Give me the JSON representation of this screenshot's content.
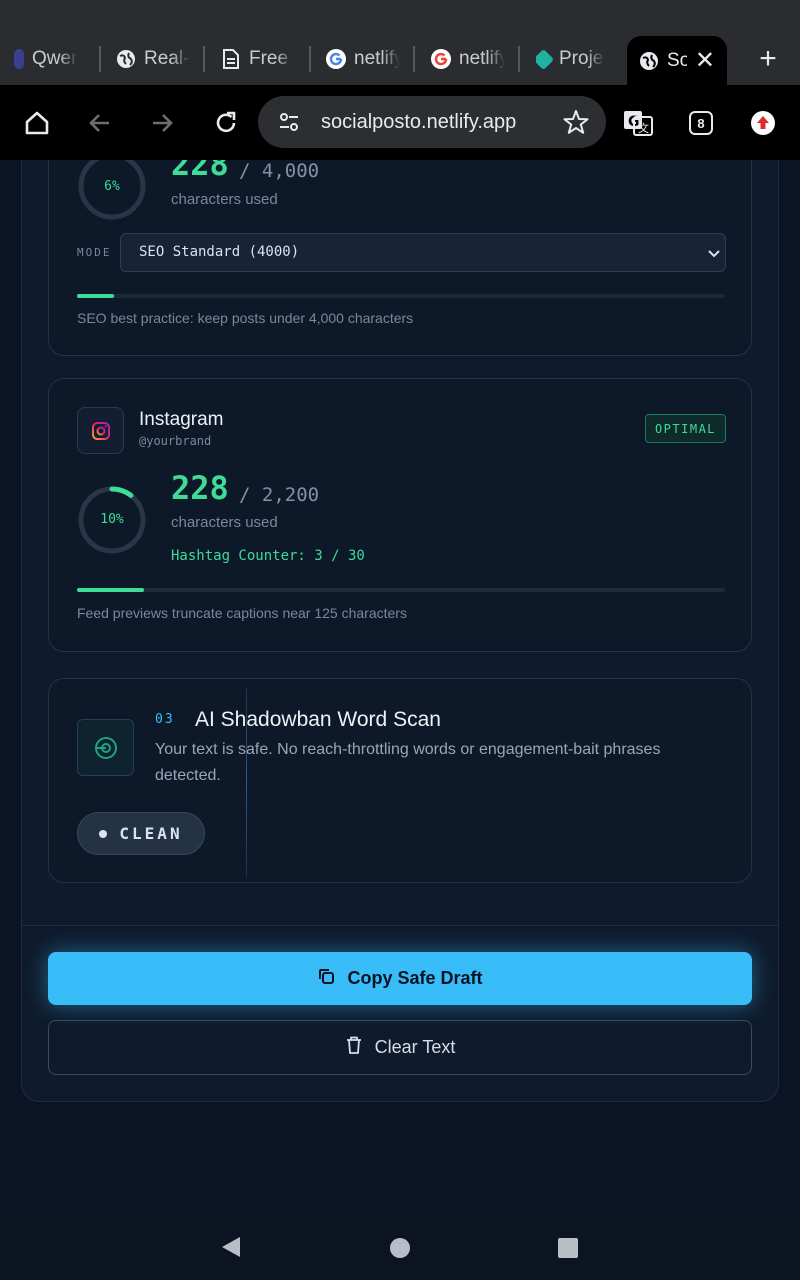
{
  "browser": {
    "tabs": [
      {
        "label": "Qwen",
        "favicon": "qwen-icon"
      },
      {
        "label": "Real-t",
        "favicon": "globe-icon"
      },
      {
        "label": "Free G",
        "favicon": "document-icon"
      },
      {
        "label": "netlify",
        "favicon": "google-icon"
      },
      {
        "label": "netlify",
        "favicon": "google-icon"
      },
      {
        "label": "Projec",
        "favicon": "netlify-icon"
      }
    ],
    "active_tab": {
      "label": "So",
      "favicon": "globe-icon"
    },
    "url": "socialposto.netlify.app",
    "tab_count": "8"
  },
  "linkedin_card": {
    "ring_percent_label": "6%",
    "ring_fraction": 0.057,
    "count": "228",
    "max": "/ 4,000",
    "count_caption": "characters used",
    "mode_label": "MODE",
    "mode_value": "SEO Standard (4000)",
    "progress_fraction": 0.057,
    "hint": "SEO best practice: keep posts under 4,000 characters"
  },
  "instagram_card": {
    "name": "Instagram",
    "handle": "@yourbrand",
    "badge": "OPTIMAL",
    "ring_percent_label": "10%",
    "ring_fraction": 0.104,
    "count": "228",
    "max": "/ 2,200",
    "count_caption": "characters used",
    "hashtag_counter": "Hashtag Counter: 3 / 30",
    "progress_fraction": 0.104,
    "hint": "Feed previews truncate captions near 125 characters"
  },
  "scan_card": {
    "number": "03",
    "title": "AI Shadowban Word Scan",
    "line1": "Your text is safe. No reach-throttling words or engagement-bait phrases",
    "line2": "detected.",
    "status": "CLEAN"
  },
  "actions": {
    "copy_label": "Copy Safe Draft",
    "clear_label": "Clear Text"
  },
  "colors": {
    "accent_green": "#3ddc97",
    "accent_blue": "#38bdf8",
    "background": "#0b1424"
  }
}
